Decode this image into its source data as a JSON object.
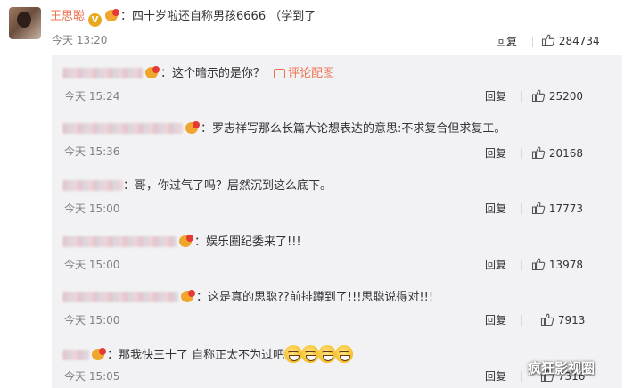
{
  "main_comment": {
    "username": "王思聪",
    "verified_badge": "V",
    "text": "：四十岁啦还自称男孩6666 （学到了",
    "time": "今天 13:20",
    "reply_label": "回复",
    "likes": "284734"
  },
  "replies": [
    {
      "username_blurred": true,
      "text": "：这个暗示的是你？",
      "extra": "评论配图",
      "time": "今天 15:24",
      "reply_label": "回复",
      "likes": "25200"
    },
    {
      "username_blurred": true,
      "text": "：罗志祥写那么长篇大论想表达的意思:不求复合但求复工。",
      "time": "今天 15:36",
      "reply_label": "回复",
      "likes": "20168"
    },
    {
      "username_blurred": true,
      "text": "：哥，你过气了吗？居然沉到这么底下。",
      "time": "今天 15:00",
      "reply_label": "回复",
      "likes": "17773"
    },
    {
      "username_blurred": true,
      "text": "：娱乐圈纪委来了!!!",
      "time": "今天 15:00",
      "reply_label": "回复",
      "likes": "13978"
    },
    {
      "username_blurred": true,
      "text": "：这是真的思聪??前排蹲到了!!!思聪说得对!!!",
      "time": "今天 15:00",
      "reply_label": "回复",
      "likes": "7913"
    },
    {
      "username_blurred": true,
      "text": "：那我快三十了 自称正太不为过吧",
      "emoji_count": 4,
      "time": "今天 15:05",
      "reply_label": "回复",
      "likes": "7316"
    }
  ],
  "watermark": "疯狂影视圈",
  "colors": {
    "accent": "#eb7350",
    "reply_bg": "#f2f2f5",
    "time": "#808080"
  },
  "icons": [
    "thumb-up-icon",
    "crown-icon",
    "verified-icon",
    "picture-icon",
    "grin-emoji-icon"
  ]
}
